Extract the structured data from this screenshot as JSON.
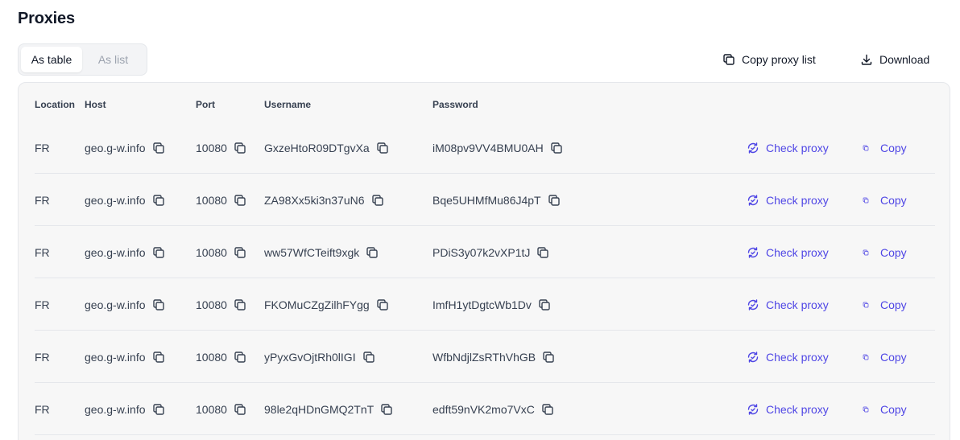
{
  "page": {
    "title": "Proxies"
  },
  "view_toggle": {
    "table_label": "As table",
    "list_label": "As list",
    "active": "table"
  },
  "actions": {
    "copy_list_label": "Copy proxy list",
    "download_label": "Download"
  },
  "colors": {
    "accent": "#4f46e5",
    "text": "#374151",
    "heading": "#111827",
    "muted": "#9ca3af",
    "card_bg": "#f7f7f7"
  },
  "table": {
    "columns": [
      "Location",
      "Host",
      "Port",
      "Username",
      "Password"
    ],
    "row_actions": {
      "check_label": "Check proxy",
      "copy_label": "Copy"
    },
    "rows": [
      {
        "location": "FR",
        "host": "geo.g-w.info",
        "port": "10080",
        "username": "GxzeHtoR09DTgvXa",
        "password": "iM08pv9VV4BMU0AH"
      },
      {
        "location": "FR",
        "host": "geo.g-w.info",
        "port": "10080",
        "username": "ZA98Xx5ki3n37uN6",
        "password": "Bqe5UHMfMu86J4pT"
      },
      {
        "location": "FR",
        "host": "geo.g-w.info",
        "port": "10080",
        "username": "ww57WfCTeift9xgk",
        "password": "PDiS3y07k2vXP1tJ"
      },
      {
        "location": "FR",
        "host": "geo.g-w.info",
        "port": "10080",
        "username": "FKOMuCZgZilhFYgg",
        "password": "ImfH1ytDgtcWb1Dv"
      },
      {
        "location": "FR",
        "host": "geo.g-w.info",
        "port": "10080",
        "username": "yPyxGvOjtRh0lIGI",
        "password": "WfbNdjlZsRThVhGB"
      },
      {
        "location": "FR",
        "host": "geo.g-w.info",
        "port": "10080",
        "username": "98le2qHDnGMQ2TnT",
        "password": "edft59nVK2mo7VxC"
      }
    ]
  }
}
